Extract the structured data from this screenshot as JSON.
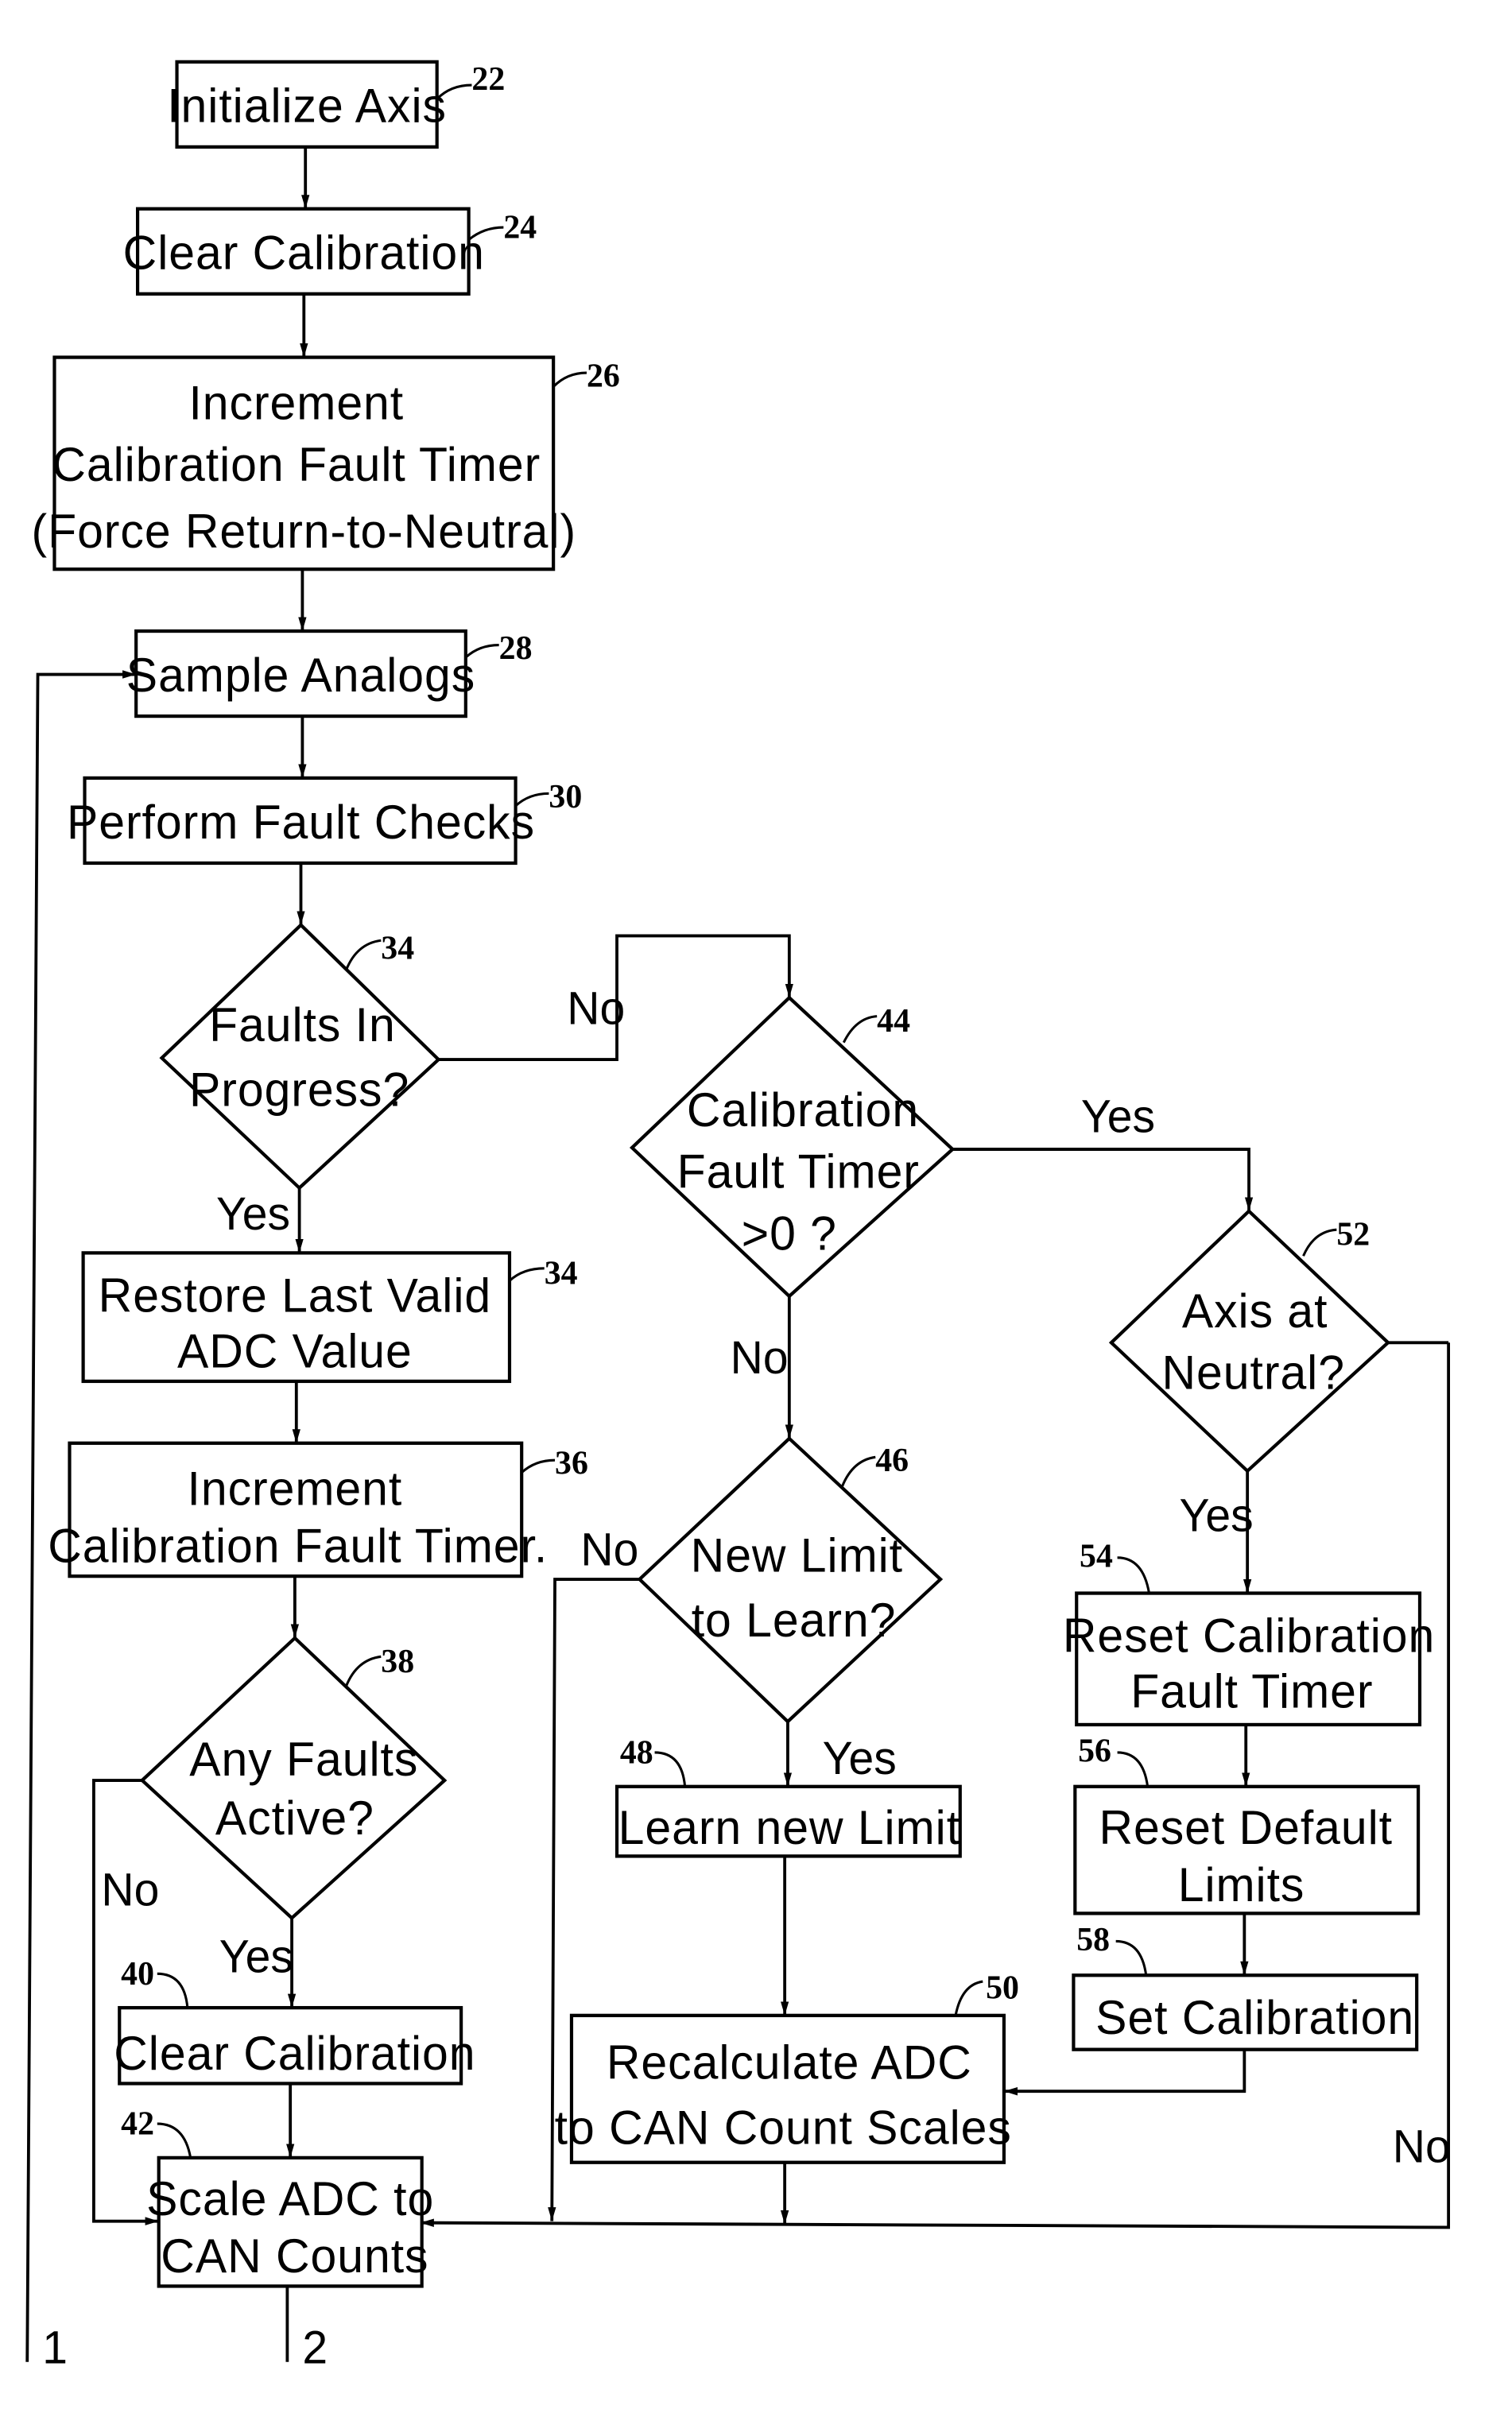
{
  "figure": {
    "type": "flowchart",
    "nodes": [
      {
        "id": "22",
        "kind": "process",
        "lines": [
          "Initialize Axis"
        ],
        "ref": "22"
      },
      {
        "id": "24",
        "kind": "process",
        "lines": [
          "Clear Calibration"
        ],
        "ref": "24"
      },
      {
        "id": "26",
        "kind": "process",
        "lines": [
          "Increment",
          "Calibration Fault Timer",
          "(Force Return-to-Neutral)"
        ],
        "ref": "26"
      },
      {
        "id": "28",
        "kind": "process",
        "lines": [
          "Sample Analogs"
        ],
        "ref": "28"
      },
      {
        "id": "30",
        "kind": "process",
        "lines": [
          "Perform Fault Checks"
        ],
        "ref": "30"
      },
      {
        "id": "34a",
        "kind": "decision",
        "lines": [
          "Faults In",
          "Progress?"
        ],
        "ref": "34"
      },
      {
        "id": "34b",
        "kind": "process",
        "lines": [
          "Restore Last Valid",
          "ADC Value"
        ],
        "ref": "34"
      },
      {
        "id": "36",
        "kind": "process",
        "lines": [
          "Increment",
          "Calibration Fault Timer."
        ],
        "ref": "36"
      },
      {
        "id": "38",
        "kind": "decision",
        "lines": [
          "Any Faults",
          "Active?"
        ],
        "ref": "38"
      },
      {
        "id": "40",
        "kind": "process",
        "lines": [
          "Clear Calibration"
        ],
        "ref": "40"
      },
      {
        "id": "42",
        "kind": "process",
        "lines": [
          "Scale ADC to",
          "CAN Counts"
        ],
        "ref": "42"
      },
      {
        "id": "44",
        "kind": "decision",
        "lines": [
          "Calibration",
          "Fault Timer",
          ">0 ?"
        ],
        "ref": "44"
      },
      {
        "id": "46",
        "kind": "decision",
        "lines": [
          "New Limit",
          "to Learn?"
        ],
        "ref": "46"
      },
      {
        "id": "48",
        "kind": "process",
        "lines": [
          "Learn new Limit"
        ],
        "ref": "48"
      },
      {
        "id": "50",
        "kind": "process",
        "lines": [
          "Recalculate ADC",
          "to CAN Count Scales"
        ],
        "ref": "50"
      },
      {
        "id": "52",
        "kind": "decision",
        "lines": [
          "Axis at",
          "Neutral?"
        ],
        "ref": "52"
      },
      {
        "id": "54",
        "kind": "process",
        "lines": [
          "Reset Calibration",
          "Fault Timer"
        ],
        "ref": "54"
      },
      {
        "id": "56",
        "kind": "process",
        "lines": [
          "Reset Default",
          "Limits"
        ],
        "ref": "56"
      },
      {
        "id": "58",
        "kind": "process",
        "lines": [
          "Set Calibration"
        ],
        "ref": "58"
      }
    ],
    "edge_labels": {
      "faults_in_progress_no": "No",
      "faults_in_progress_yes": "Yes",
      "cal_timer_yes": "Yes",
      "cal_timer_no": "No",
      "new_limit_no": "No",
      "new_limit_yes": "Yes",
      "axis_neutral_yes": "Yes",
      "axis_neutral_no": "No",
      "any_faults_no": "No",
      "any_faults_yes": "Yes"
    },
    "connectors": {
      "left": "1",
      "bottom": "2"
    }
  }
}
